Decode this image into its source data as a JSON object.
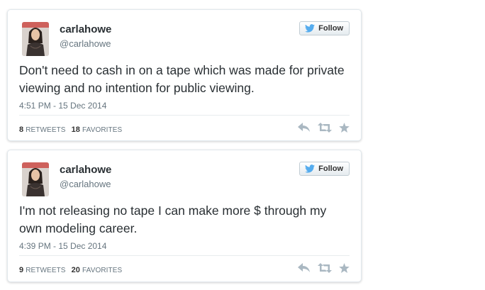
{
  "tweets": [
    {
      "display_name": "carlahowe",
      "screen_name": "@carlahowe",
      "follow_label": "Follow",
      "text": "Don't need to cash in on a tape which was made for private viewing and no intention for public viewing.",
      "timestamp": "4:51 PM - 15 Dec 2014",
      "retweets_count": "8",
      "retweets_label": "RETWEETS",
      "favorites_count": "18",
      "favorites_label": "FAVORITES"
    },
    {
      "display_name": "carlahowe",
      "screen_name": "@carlahowe",
      "follow_label": "Follow",
      "text": "I'm not releasing no tape I can make more $ through my own modeling career.",
      "timestamp": "4:39 PM - 15 Dec 2014",
      "retweets_count": "9",
      "retweets_label": "RETWEETS",
      "favorites_count": "20",
      "favorites_label": "FAVORITES"
    }
  ],
  "icons": {
    "follow": "twitter-bird-icon",
    "reply": "reply-icon",
    "retweet": "retweet-icon",
    "favorite": "star-icon"
  },
  "colors": {
    "bird": "#55acee",
    "action_icons": "#aab8c2",
    "text": "#292f33",
    "muted": "#66757f"
  }
}
